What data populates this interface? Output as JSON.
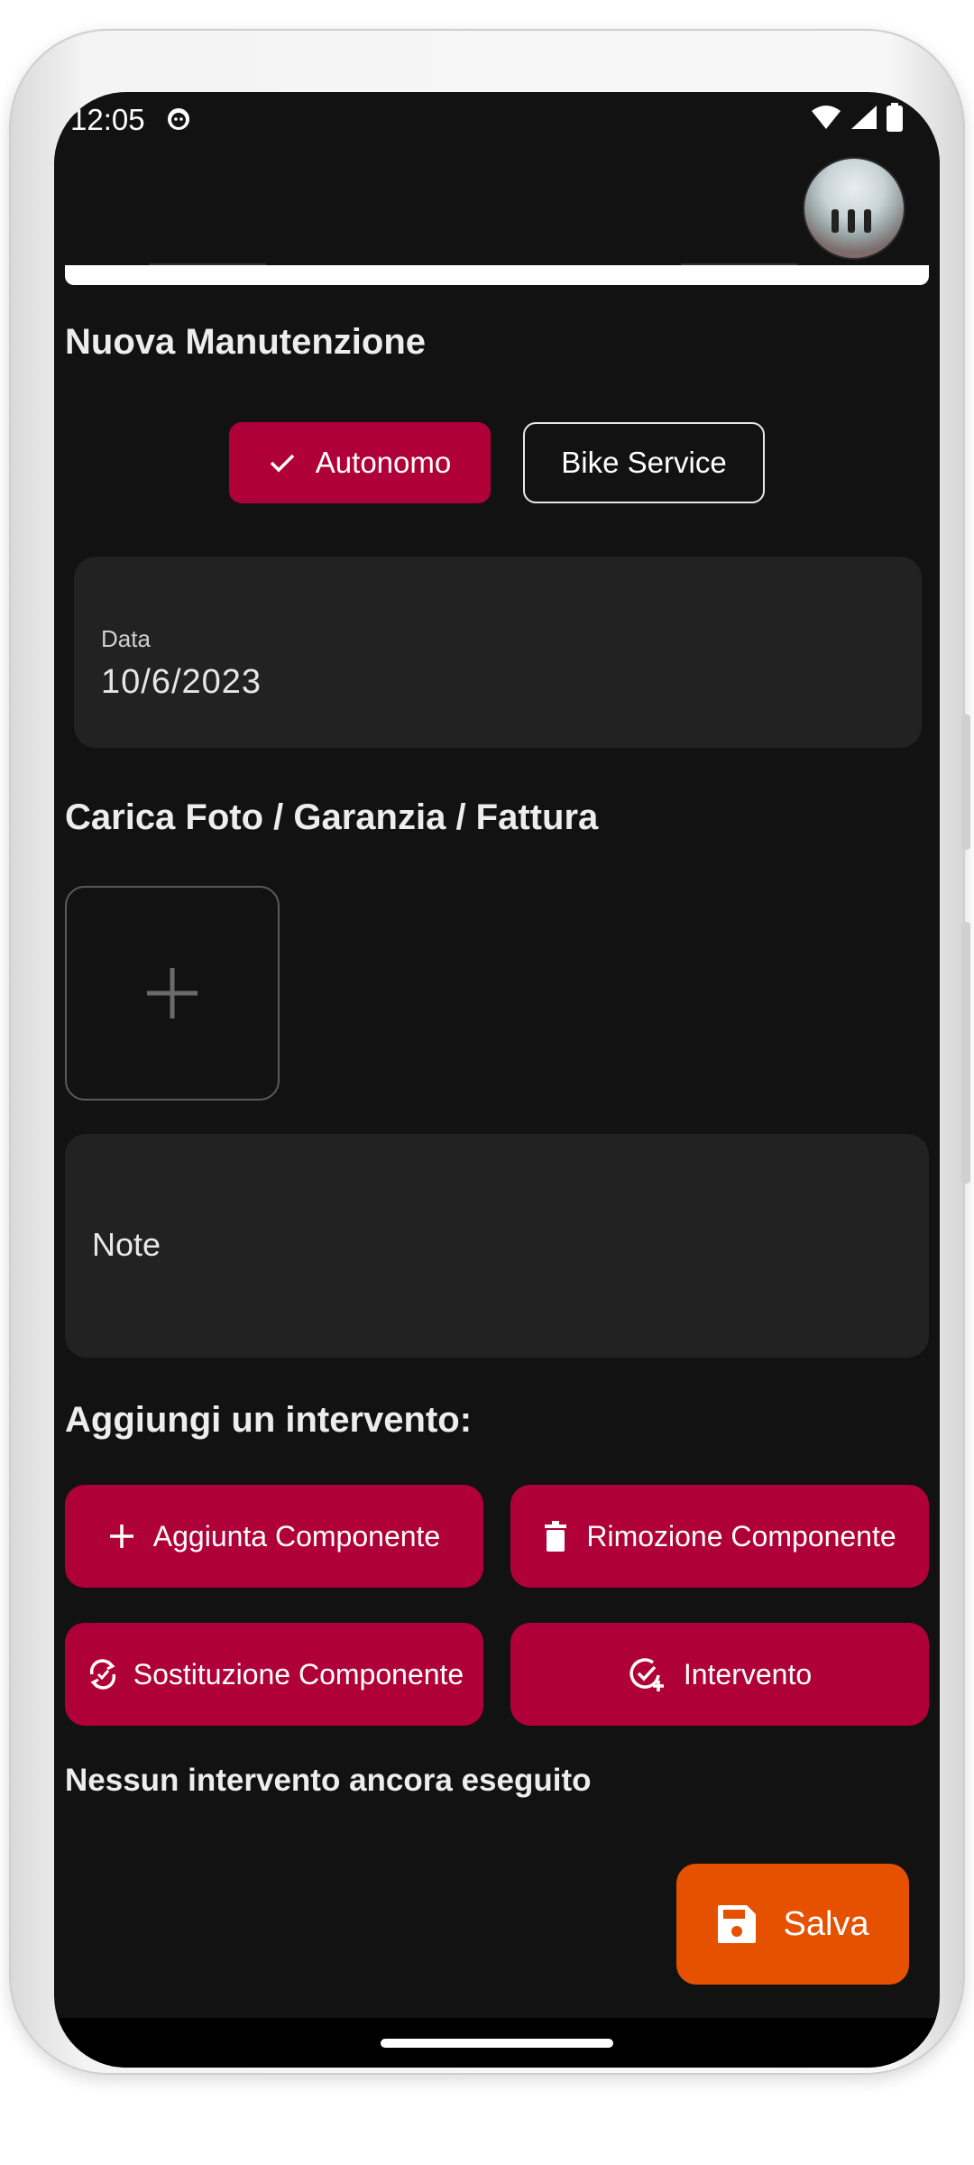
{
  "status_bar": {
    "time": "12:05"
  },
  "app_bar": {
    "avatar_icon": "user-avatar-photo"
  },
  "form": {
    "title": "Nuova Manutenzione",
    "mode_toggle": {
      "autonomo_label": "Autonomo",
      "bike_service_label": "Bike Service",
      "selected": "Autonomo"
    },
    "date_label": "Data",
    "date_value": "10/6/2023",
    "upload_title": "Carica Foto / Garanzia / Fattura",
    "note_label": "Note"
  },
  "interventions": {
    "title": "Aggiungi un intervento:",
    "buttons": [
      {
        "label": "Aggiunta Componente",
        "icon": "plus-icon"
      },
      {
        "label": "Rimozione Componente",
        "icon": "trash-icon"
      },
      {
        "label": "Sostituzione Componente",
        "icon": "swap-icon"
      },
      {
        "label": "Intervento",
        "icon": "check-add-icon"
      }
    ],
    "empty_text": "Nessun intervento ancora eseguito"
  },
  "fab": {
    "label": "Salva",
    "icon": "save-icon"
  },
  "colors": {
    "background": "#121212",
    "primary": "#b0003a",
    "fab": "#e65100",
    "field": "#222222"
  }
}
